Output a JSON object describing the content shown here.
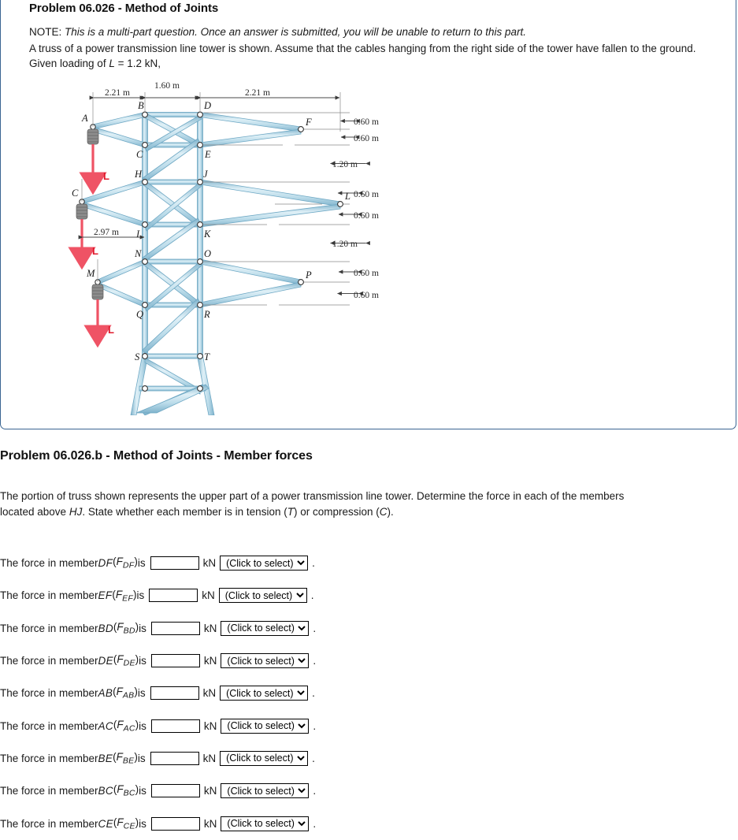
{
  "problem": {
    "title": "Problem 06.026 - Method of Joints",
    "note_label": "NOTE:",
    "note_text": "This is a multi-part question. Once an answer is submitted, you will be unable to return to this part.",
    "intro_before": "A truss of a power transmission line tower is shown. Assume that the cables hanging from the right side of the tower have fallen to the ground. Given loading of ",
    "intro_var": "L",
    "intro_after": " = 1.2 kN,"
  },
  "figure": {
    "horizontal_dims": [
      "2.21 m",
      "1.60 m",
      "2.21 m"
    ],
    "left_dim": "2.97 m",
    "vertical_dims": [
      "0.60 m",
      "0.60 m",
      "1.20 m",
      "0.60 m",
      "0.60 m",
      "1.20 m",
      "0.60 m",
      "0.60 m"
    ],
    "load_labels": [
      "L",
      "L",
      "L"
    ],
    "joint_labels": [
      "A",
      "B",
      "D",
      "F",
      "C",
      "E",
      "H",
      "J",
      "C",
      "L",
      "I",
      "K",
      "N",
      "O",
      "M",
      "P",
      "Q",
      "R",
      "S",
      "T"
    ],
    "member_color": "#a9cfe2",
    "member_edge_color": "#5b93b0",
    "load_color": "#ef5365",
    "dim_color": "#4a4a4a"
  },
  "part": {
    "title": "Problem 06.026.b - Method of Joints - Member forces",
    "description_1": "The portion of truss shown represents the upper part of a power transmission line tower. Determine the force in each of the members",
    "description_2_a": "located above ",
    "description_2_hj": "HJ",
    "description_2_b": ". State whether each member is in tension (",
    "description_2_t": "T",
    "description_2_c": ") or compression (",
    "description_2_c2": "C",
    "description_2_end": ")."
  },
  "answers": {
    "prefix": "The force in member ",
    "is_word": " is",
    "unit": "kN",
    "period": ".",
    "select_placeholder": "(Click to select)",
    "select_options": [
      "(Click to select)",
      "T",
      "C"
    ],
    "input_value": "",
    "rows": [
      {
        "member": "DF",
        "sub": "DF",
        "value": ""
      },
      {
        "member": "EF",
        "sub": "EF",
        "value": ""
      },
      {
        "member": "BD",
        "sub": "BD",
        "value": ""
      },
      {
        "member": "DE",
        "sub": "DE",
        "value": ""
      },
      {
        "member": "AB",
        "sub": "AB",
        "value": ""
      },
      {
        "member": "AC",
        "sub": "AC",
        "value": ""
      },
      {
        "member": "BE",
        "sub": "BE",
        "value": ""
      },
      {
        "member": "BC",
        "sub": "BC",
        "value": ""
      },
      {
        "member": "CE",
        "sub": "CE",
        "value": ""
      }
    ]
  }
}
